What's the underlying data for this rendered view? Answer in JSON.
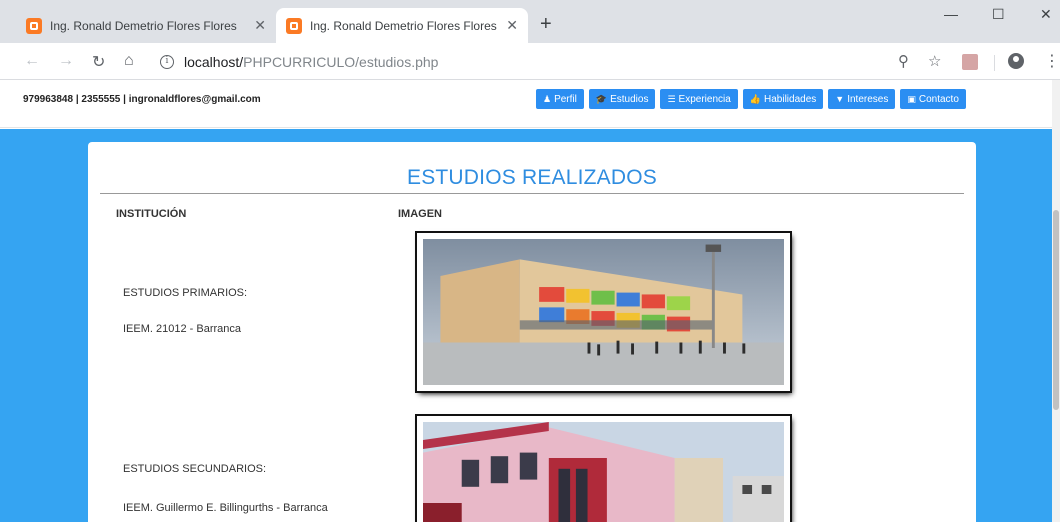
{
  "browser": {
    "tabs": [
      {
        "title": "Ing. Ronald Demetrio Flores Flores",
        "active": false
      },
      {
        "title": "Ing. Ronald Demetrio Flores Flores",
        "active": true
      }
    ],
    "new_tab": "+",
    "window_controls": {
      "minimize": "—",
      "maximize": "☐",
      "close": "✕"
    },
    "url_host": "localhost/",
    "url_path": "PHPCURRICULO/estudios.php"
  },
  "site": {
    "contact_line": "979963848 | 2355555 | ingronaldflores@gmail.com",
    "nav": [
      {
        "label": "Perfil",
        "icon": "person-icon",
        "glyph": "♟"
      },
      {
        "label": "Estudios",
        "icon": "graduation-cap-icon",
        "glyph": "🎓"
      },
      {
        "label": "Experiencia",
        "icon": "database-icon",
        "glyph": "☰"
      },
      {
        "label": "Habilidades",
        "icon": "thumbs-up-icon",
        "glyph": "👍"
      },
      {
        "label": "Intereses",
        "icon": "filter-icon",
        "glyph": "▼"
      },
      {
        "label": "Contacto",
        "icon": "contact-card-icon",
        "glyph": "▣"
      }
    ]
  },
  "content": {
    "heading": "ESTUDIOS REALIZADOS",
    "col_institution": "INSTITUCIÓN",
    "col_image": "IMAGEN",
    "studies": [
      {
        "type": "ESTUDIOS PRIMARIOS:",
        "institution": "IEEM. 21012 - Barranca",
        "image": "school-building-photo"
      },
      {
        "type": "ESTUDIOS SECUNDARIOS:",
        "institution": "IEEM. Guillermo E. Billingurths - Barranca",
        "image": "secondary-school-photo"
      }
    ]
  },
  "colors": {
    "page_background": "#35a4f2",
    "nav_button": "#2b8ef2",
    "heading": "#2f8de0"
  }
}
